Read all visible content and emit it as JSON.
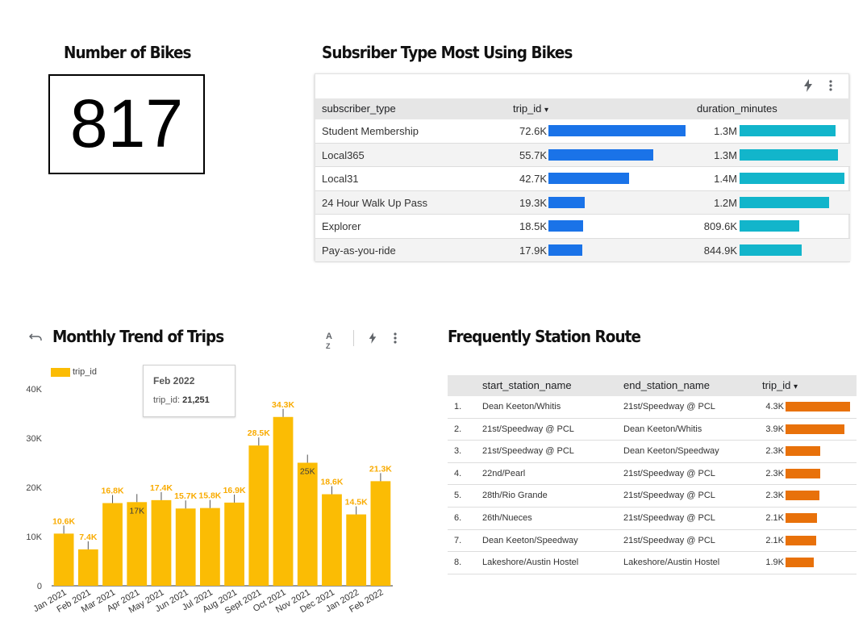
{
  "kpi": {
    "title": "Number of Bikes",
    "value": "817"
  },
  "subscriber_table": {
    "title": "Subsriber Type Most Using Bikes",
    "columns": {
      "type": "subscriber_type",
      "trips": "trip_id",
      "sort_arrow": "▾",
      "duration": "duration_minutes"
    },
    "rows": [
      {
        "label": "Student Membership",
        "trips_label": "72.6K",
        "trips": 72.6,
        "duration_label": "1.3M",
        "duration": 1300
      },
      {
        "label": "Local365",
        "trips_label": "55.7K",
        "trips": 55.7,
        "duration_label": "1.3M",
        "duration": 1330
      },
      {
        "label": "Local31",
        "trips_label": "42.7K",
        "trips": 42.7,
        "duration_label": "1.4M",
        "duration": 1420
      },
      {
        "label": "24 Hour Walk Up Pass",
        "trips_label": "19.3K",
        "trips": 19.3,
        "duration_label": "1.2M",
        "duration": 1210
      },
      {
        "label": "Explorer",
        "trips_label": "18.5K",
        "trips": 18.5,
        "duration_label": "809.6K",
        "duration": 809.6
      },
      {
        "label": "Pay-as-you-ride",
        "trips_label": "17.9K",
        "trips": 17.9,
        "duration_label": "844.9K",
        "duration": 844.9
      }
    ],
    "icons": [
      "bolt-icon",
      "more-vert-icon"
    ]
  },
  "trend": {
    "title": "Monthly Trend of Trips",
    "icons": [
      "undo-icon",
      "sort-az-icon",
      "bolt-icon",
      "more-vert-icon"
    ],
    "tooltip": {
      "title": "Feb 2022",
      "label": "trip_id: ",
      "value": "21,251"
    }
  },
  "chart_data": {
    "type": "bar",
    "legend": [
      "trip_id"
    ],
    "categories": [
      "Jan 2021",
      "Feb 2021",
      "Mar 2021",
      "Apr 2021",
      "May 2021",
      "Jun 2021",
      "Jul 2021",
      "Aug 2021",
      "Sept 2021",
      "Oct 2021",
      "Nov 2021",
      "Dec 2021",
      "Jan 2022",
      "Feb 2022"
    ],
    "values": [
      10600,
      7400,
      16800,
      17000,
      17400,
      15700,
      15800,
      16900,
      28500,
      34300,
      25000,
      18600,
      14500,
      21251
    ],
    "value_labels": [
      "10.6K",
      "7.4K",
      "16.8K",
      "17K",
      "17.4K",
      "15.7K",
      "15.8K",
      "16.9K",
      "28.5K",
      "34.3K",
      "25K",
      "18.6K",
      "14.5K",
      "21.3K"
    ],
    "yticks": [
      "0",
      "10K",
      "20K",
      "30K",
      "40K"
    ],
    "ylim": [
      0,
      40000
    ],
    "colors": {
      "bar": "#fbbc04",
      "label": "#f9ab00",
      "label_dark": "#3c3c3c"
    }
  },
  "route_table": {
    "title": "Frequently Station Route",
    "columns": {
      "start": "start_station_name",
      "end": "end_station_name",
      "trips": "trip_id",
      "sort_arrow": "▾"
    },
    "rows": [
      {
        "rank": "1.",
        "start": "Dean Keeton/Whitis",
        "end": "21st/Speedway @ PCL",
        "trips_label": "4.3K",
        "trips": 4.3
      },
      {
        "rank": "2.",
        "start": "21st/Speedway @ PCL",
        "end": "Dean Keeton/Whitis",
        "trips_label": "3.9K",
        "trips": 3.9
      },
      {
        "rank": "3.",
        "start": "21st/Speedway @ PCL",
        "end": "Dean Keeton/Speedway",
        "trips_label": "2.3K",
        "trips": 2.3
      },
      {
        "rank": "4.",
        "start": "22nd/Pearl",
        "end": "21st/Speedway @ PCL",
        "trips_label": "2.3K",
        "trips": 2.3
      },
      {
        "rank": "5.",
        "start": "28th/Rio Grande",
        "end": "21st/Speedway @ PCL",
        "trips_label": "2.3K",
        "trips": 2.25
      },
      {
        "rank": "6.",
        "start": "26th/Nueces",
        "end": "21st/Speedway @ PCL",
        "trips_label": "2.1K",
        "trips": 2.1
      },
      {
        "rank": "7.",
        "start": "Dean Keeton/Speedway",
        "end": "21st/Speedway @ PCL",
        "trips_label": "2.1K",
        "trips": 2.05
      },
      {
        "rank": "8.",
        "start": "Lakeshore/Austin Hostel",
        "end": "Lakeshore/Austin Hostel",
        "trips_label": "1.9K",
        "trips": 1.9
      }
    ]
  }
}
